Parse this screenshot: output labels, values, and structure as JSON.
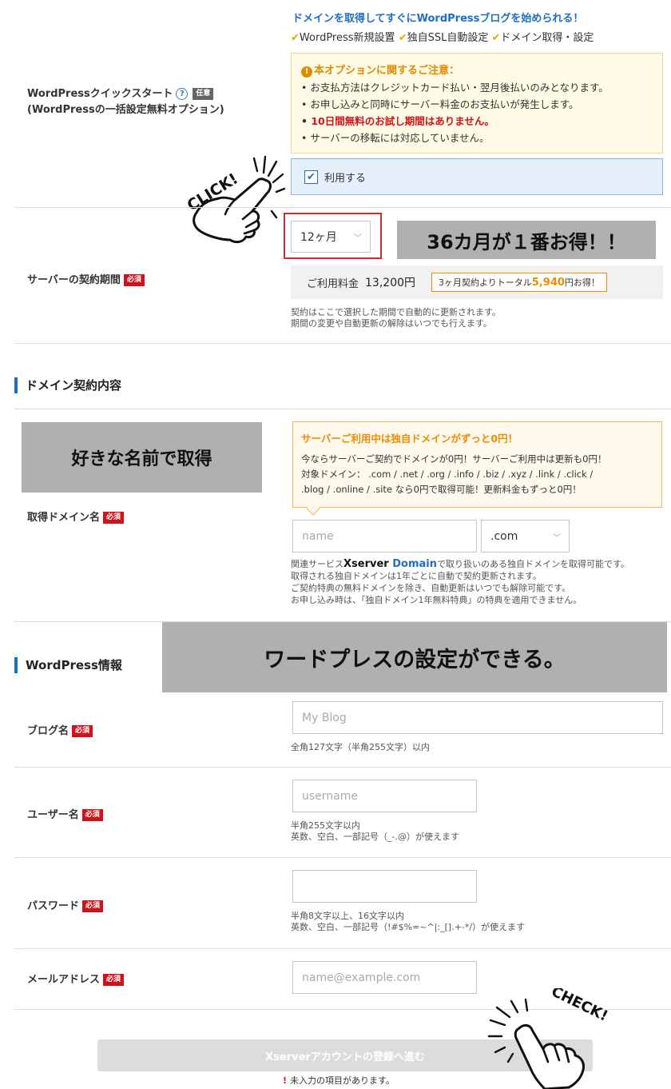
{
  "wp_quickstart": {
    "label_line1": "WordPressクイックスタート",
    "help_icon": "?",
    "optional_badge": "任意",
    "label_line2": "(WordPressの一括設定無料オプション)",
    "promo_title": "ドメインを取得してすぐにWordPressブログを始められる！",
    "feature1": "WordPress新規設置",
    "feature2": "独自SSL自動設定",
    "feature3": "ドメイン取得・設定",
    "notice_title": "本オプションに関するご注意：",
    "notice_items": [
      "お支払方法はクレジットカード払い・翌月後払いのみとなります。",
      "お申し込みと同時にサーバー料金のお支払いが発生します。",
      "10日間無料のお試し期間はありません。",
      "サーバーの移転には対応していません。"
    ],
    "use_checkbox_label": "利用する",
    "use_checked": true,
    "click_doodle": "CLICK!"
  },
  "contract": {
    "label": "サーバーの契約期間",
    "required_badge": "必須",
    "period_selected": "12ヶ月",
    "overlay_text": "36カ月が１番お得！！",
    "fee_label": "ご利用料金",
    "fee_value": "13,200円",
    "savings_prefix": "3ヶ月契約よりトータル",
    "savings_amount": "5,940",
    "savings_suffix": "円お得！",
    "note_line1": "契約はここで選択した期間で自動的に更新されます。",
    "note_line2": "期間の変更や自動更新の解除はいつでも行えます。"
  },
  "domain_section": {
    "heading": "ドメイン契約内容",
    "overlay_text": "好きな名前で取得",
    "label": "取得ドメイン名",
    "required_badge": "必須",
    "promo_title": "サーバーご利用中は独自ドメインがずっと0円！",
    "promo_line1": "今ならサーバーご契約でドメインが0円！サーバーご利用中は更新も0円！",
    "promo_line2": "対象ドメイン： .com / .net / .org / .info / .biz / .xyz / .link / .click /",
    "promo_line3": ".blog / .online / .site なら0円で取得可能！更新料金もずっと0円！",
    "name_placeholder": "name",
    "tld_selected": ".com",
    "note_prefix": "関連サービス",
    "brand_x": "Xserver",
    "brand_domain": "Domain",
    "note_suffix": "で取り扱いのある独自ドメインを取得可能です。",
    "note_line2": "取得される独自ドメインは1年ごとに自動で契約更新されます。",
    "note_line3": "ご契約特典の無料ドメインを除き、自動更新はいつでも解除可能です。",
    "note_line4": "お申し込み時は、「独自ドメイン1年無料特典」の特典を適用できません。"
  },
  "wp_section": {
    "heading": "WordPress情報",
    "overlay_text": "ワードプレスの設定ができる。",
    "blog_label": "ブログ名",
    "blog_placeholder": "My Blog",
    "blog_note": "全角127文字（半角255文字）以内",
    "user_label": "ユーザー名",
    "user_placeholder": "username",
    "user_note1": "半角255文字以内",
    "user_note2": "英数、空白、一部記号（_-.@）が使えます",
    "pass_label": "パスワード",
    "pass_note1": "半角8文字以上、16文字以内",
    "pass_note2": "英数、空白、一部記号（!#$%=~^|:_[].+-*/）が使えます",
    "mail_label": "メールアドレス",
    "mail_placeholder": "name@example.com",
    "required_badge": "必須"
  },
  "submit": {
    "button_label": "Xserverアカウントの登録へ進む",
    "error_icon": "!",
    "error_text": "未入力の項目があります。",
    "check_doodle": "CHECK!"
  },
  "colors": {
    "accent_blue": "#1f6fbf",
    "required_red": "#d0121b",
    "promo_orange": "#f08c00",
    "overlay_gray": "#b0b0b0"
  }
}
